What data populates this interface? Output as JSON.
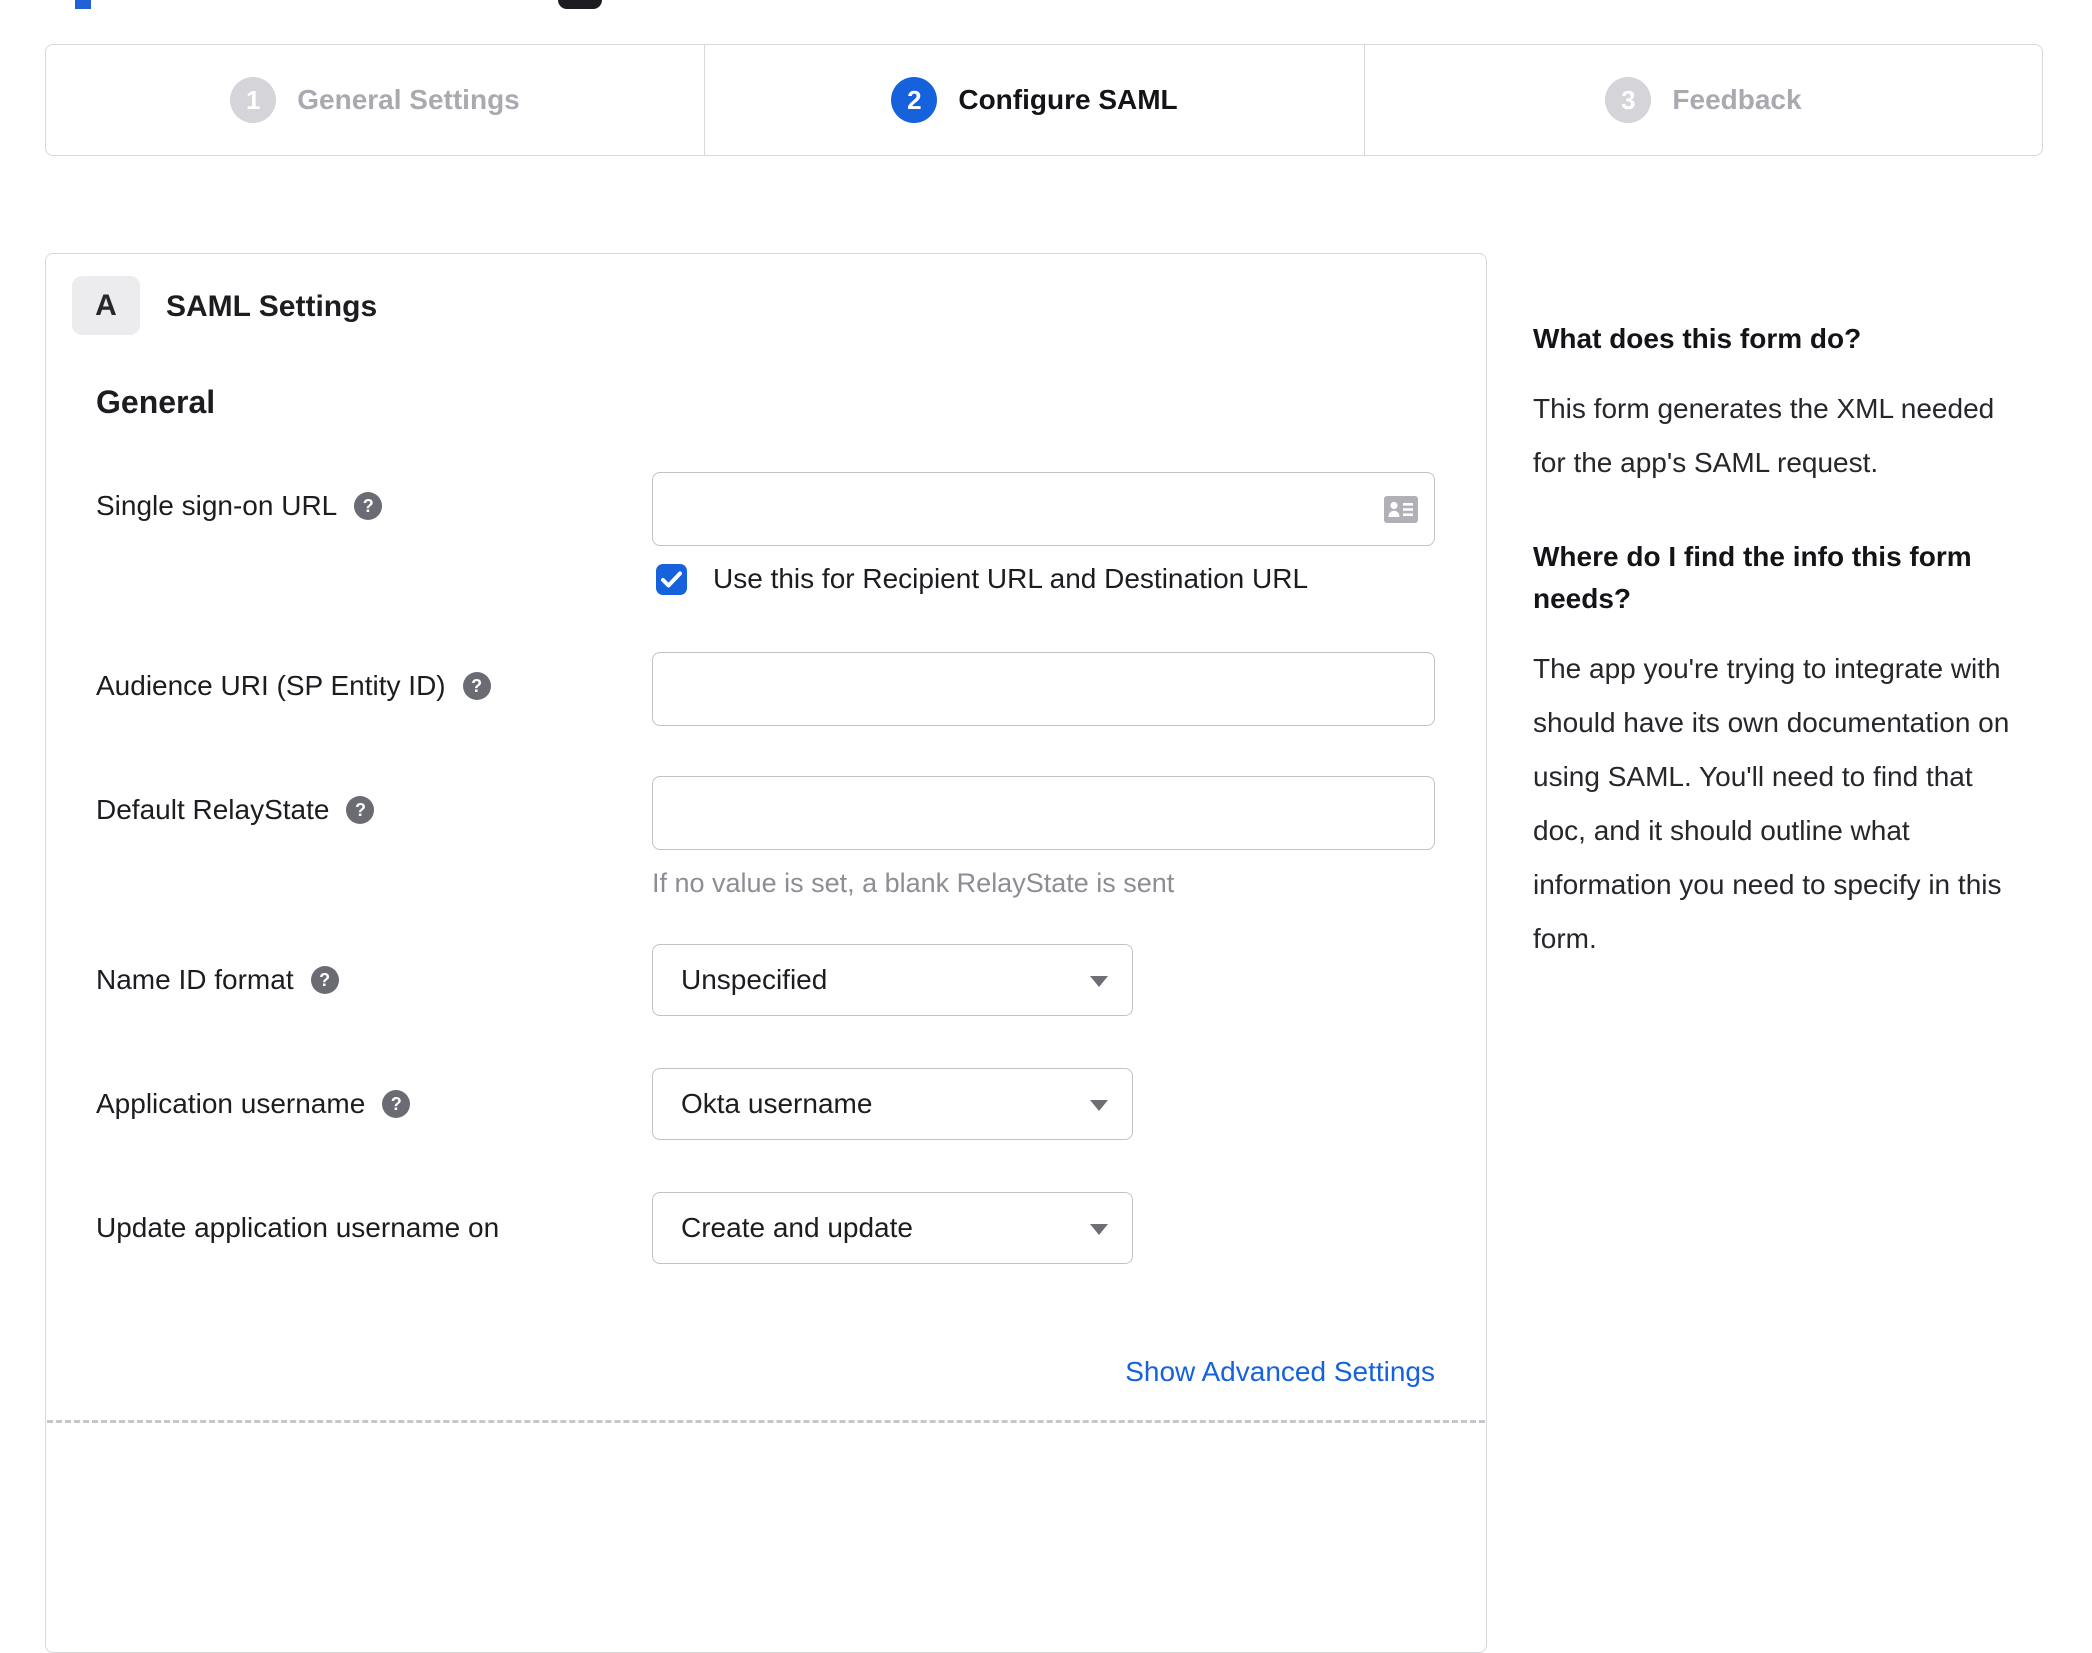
{
  "colors": {
    "accent_blue": "#1662dd",
    "text_dark": "#1d1d21",
    "muted_gray": "#8d8d95",
    "inactive_gray": "#a9a9b0",
    "border_gray": "#d8d8dc"
  },
  "icons": {
    "help_glyph": "?"
  },
  "stepper": {
    "steps": [
      {
        "number": "1",
        "label": "General Settings",
        "state": "inactive"
      },
      {
        "number": "2",
        "label": "Configure SAML",
        "state": "active"
      },
      {
        "number": "3",
        "label": "Feedback",
        "state": "inactive"
      }
    ]
  },
  "form": {
    "section_letter": "A",
    "section_title": "SAML Settings",
    "group_title": "General",
    "fields": [
      {
        "label": "Single sign-on URL",
        "control": "text",
        "value": "",
        "checkbox_label": "Use this for Recipient URL and Destination URL",
        "checkbox_checked": true
      },
      {
        "label": "Audience URI (SP Entity ID)",
        "control": "text",
        "value": ""
      },
      {
        "label": "Default RelayState",
        "control": "text",
        "value": "",
        "hint": "If no value is set, a blank RelayState is sent"
      },
      {
        "label": "Name ID format",
        "control": "select",
        "value": "Unspecified"
      },
      {
        "label": "Application username",
        "control": "select",
        "value": "Okta username"
      },
      {
        "label": "Update application username on",
        "control": "select",
        "value": "Create and update"
      }
    ],
    "advanced_link": "Show Advanced Settings"
  },
  "help_panel": {
    "sections": [
      {
        "heading": "What does this form do?",
        "body": "This form generates the XML needed for the app's SAML request."
      },
      {
        "heading": "Where do I find the info this form needs?",
        "body": "The app you're trying to integrate with should have its own documentation on using SAML. You'll need to find that doc, and it should outline what information you need to specify in this form."
      }
    ]
  }
}
